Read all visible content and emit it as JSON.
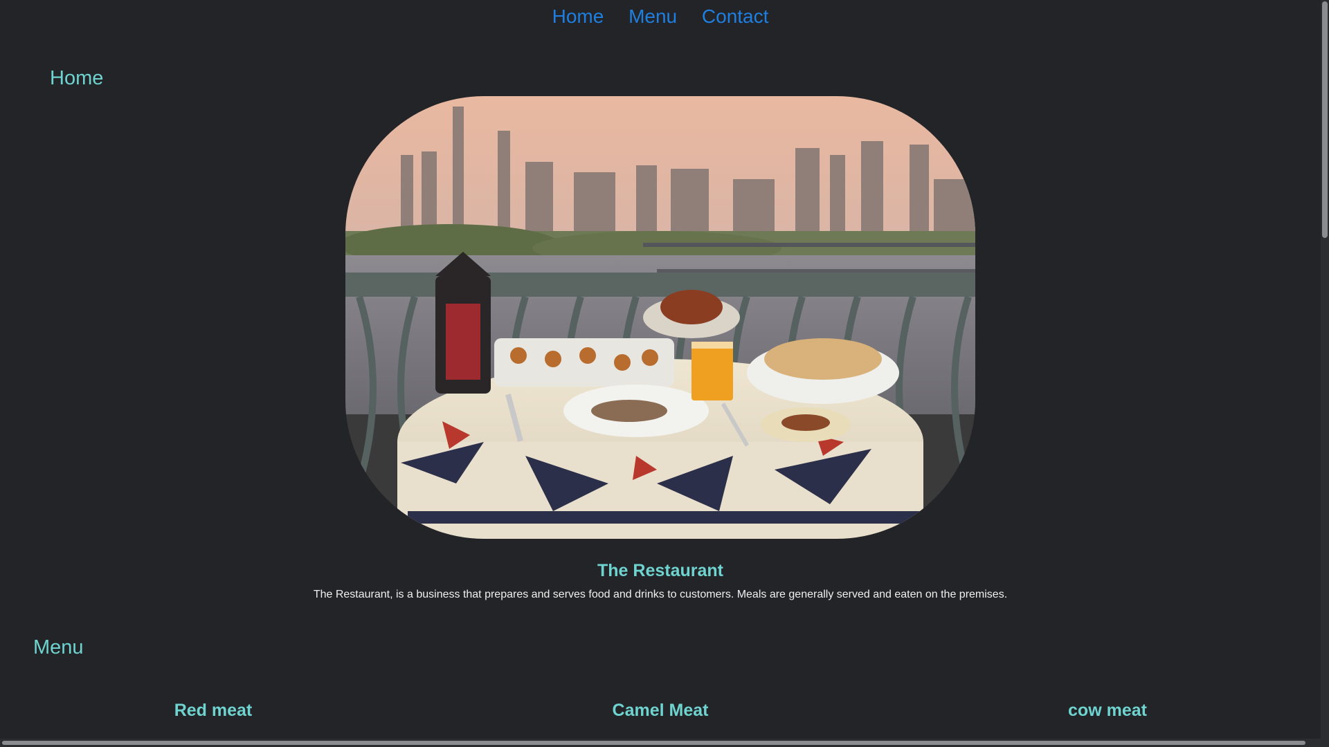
{
  "nav": {
    "links": [
      "Home",
      "Menu",
      "Contact"
    ]
  },
  "sections": {
    "home_title": "Home",
    "menu_title": "Menu"
  },
  "hero": {
    "image": "restaurant-balcony-photo"
  },
  "restaurant": {
    "heading": "The Restaurant",
    "description": "The Restaurant, is a business that prepares and serves food and drinks to customers. Meals are generally served and eaten on the premises."
  },
  "menu": {
    "categories": [
      "Red meat",
      "Camel Meat",
      "cow meat"
    ]
  },
  "colors": {
    "background": "#232427",
    "link": "#1e7fe0",
    "accent": "#6fd3cf",
    "text": "#f0f0f0"
  }
}
